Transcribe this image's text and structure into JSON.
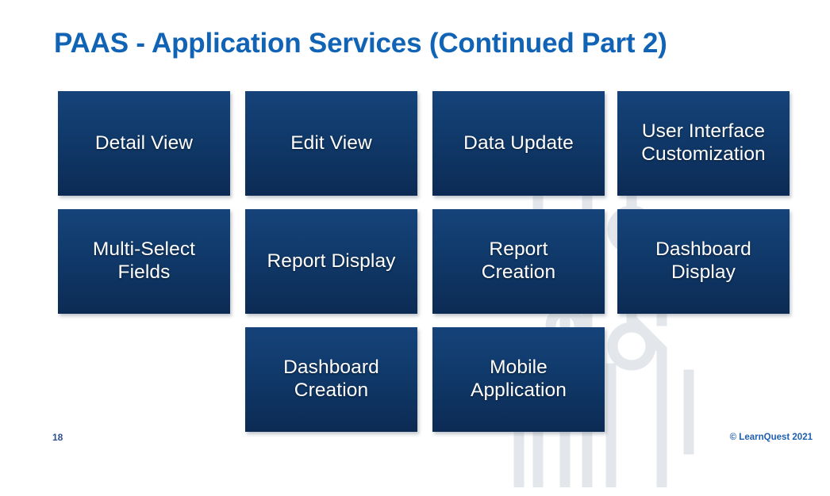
{
  "slide": {
    "title": "PAAS - Application Services (Continued Part 2)",
    "page_number": "18",
    "copyright": "© LearnQuest 2021",
    "colors": {
      "title_blue": "#1163b6",
      "box_top": "#15437a",
      "box_bottom": "#0c2b54",
      "box_text": "#ffffff",
      "page_number": "#2e4f8f",
      "copyright": "#1f5fb0",
      "watermark": "#e2e5e9",
      "background": "#ffffff"
    },
    "watermark_name": "circuit-board-graphic"
  },
  "boxes": [
    {
      "id": "detail-view",
      "label": "Detail View",
      "row": 1,
      "col": 1
    },
    {
      "id": "edit-view",
      "label": "Edit View",
      "row": 1,
      "col": 2
    },
    {
      "id": "data-update",
      "label": "Data Update",
      "row": 1,
      "col": 3
    },
    {
      "id": "user-interface-customization",
      "label": "User Interface\nCustomization",
      "row": 1,
      "col": 4
    },
    {
      "id": "multi-select-fields",
      "label": "Multi-Select\nFields",
      "row": 2,
      "col": 1
    },
    {
      "id": "report-display",
      "label": "Report Display",
      "row": 2,
      "col": 2
    },
    {
      "id": "report-creation",
      "label": "Report\nCreation",
      "row": 2,
      "col": 3
    },
    {
      "id": "dashboard-display",
      "label": "Dashboard\nDisplay",
      "row": 2,
      "col": 4
    },
    {
      "id": "dashboard-creation",
      "label": "Dashboard\nCreation",
      "row": 3,
      "col": 2
    },
    {
      "id": "mobile-application",
      "label": "Mobile\nApplication",
      "row": 3,
      "col": 3
    }
  ]
}
